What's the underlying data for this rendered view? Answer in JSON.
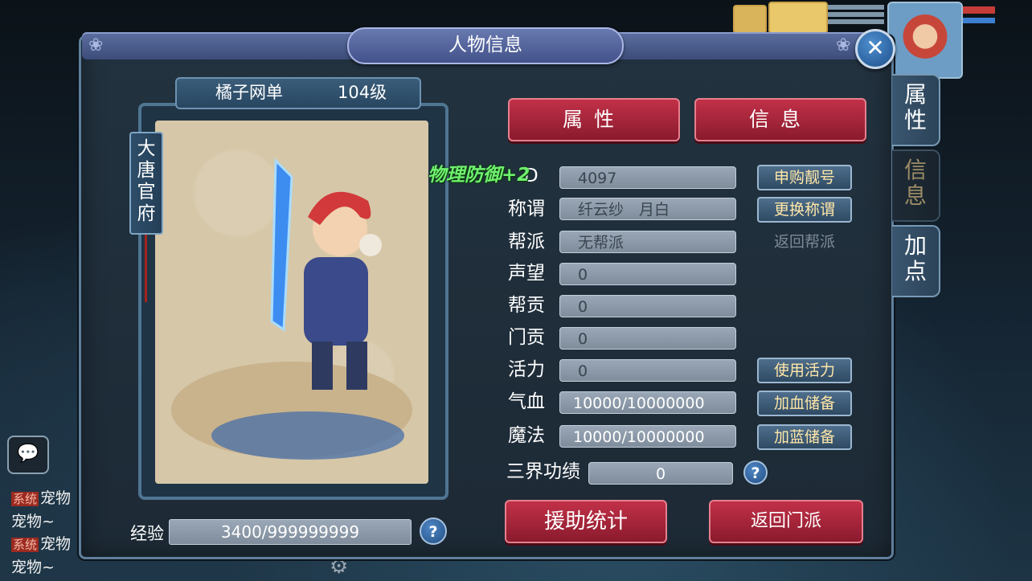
{
  "window": {
    "title": "人物信息",
    "close_glyph": "✕",
    "colors": {
      "panel": "#1d2a36",
      "tab_red": "#a42338",
      "accent_border": "#5f7f9b"
    }
  },
  "side_tabs": [
    {
      "label": "属\n性",
      "active": true
    },
    {
      "label": "信\n息",
      "active": false
    },
    {
      "label": "加\n点",
      "active": true
    }
  ],
  "character": {
    "name": "橘子网单",
    "level": "104级",
    "sect": "大\n唐\n官\n府"
  },
  "tabs": {
    "attributes": "属性",
    "info": "信息"
  },
  "float_text": "物理防御+2",
  "stats": {
    "id_value": "4097",
    "id_label_partial": "D",
    "title_label": "称谓",
    "title_value": "纤云纱　月白",
    "guild_label": "帮派",
    "guild_value": "无帮派",
    "prestige_label": "声望",
    "prestige_value": "0",
    "guild_contrib_label": "帮贡",
    "guild_contrib_value": "0",
    "sect_contrib_label": "门贡",
    "sect_contrib_value": "0",
    "vitality_label": "活力",
    "vitality_value": "0",
    "hp_label": "气血",
    "hp_value": "10000/10000000",
    "mp_label": "魔法",
    "mp_value": "10000/10000000",
    "merit_label": "三界功绩",
    "merit_value": "0"
  },
  "buttons": {
    "buy_number": "申购靓号",
    "change_title": "更换称谓",
    "return_guild": "返回帮派",
    "use_vitality": "使用活力",
    "hp_reserve": "加血储备",
    "mp_reserve": "加蓝储备",
    "assist_stats": "援助统计",
    "return_sect": "返回门派"
  },
  "experience": {
    "label": "经验",
    "value": "3400/999999999"
  },
  "help_glyph": "?",
  "chat": {
    "lines": [
      {
        "tag": "系统",
        "text": "宠物"
      },
      {
        "tag": "",
        "text": "宠物~"
      },
      {
        "tag": "系统",
        "text": "宠物"
      },
      {
        "tag": "",
        "text": "宠物~"
      }
    ]
  },
  "icons": [
    "chat-icon",
    "gear-icon",
    "close-icon",
    "help-icon"
  ]
}
